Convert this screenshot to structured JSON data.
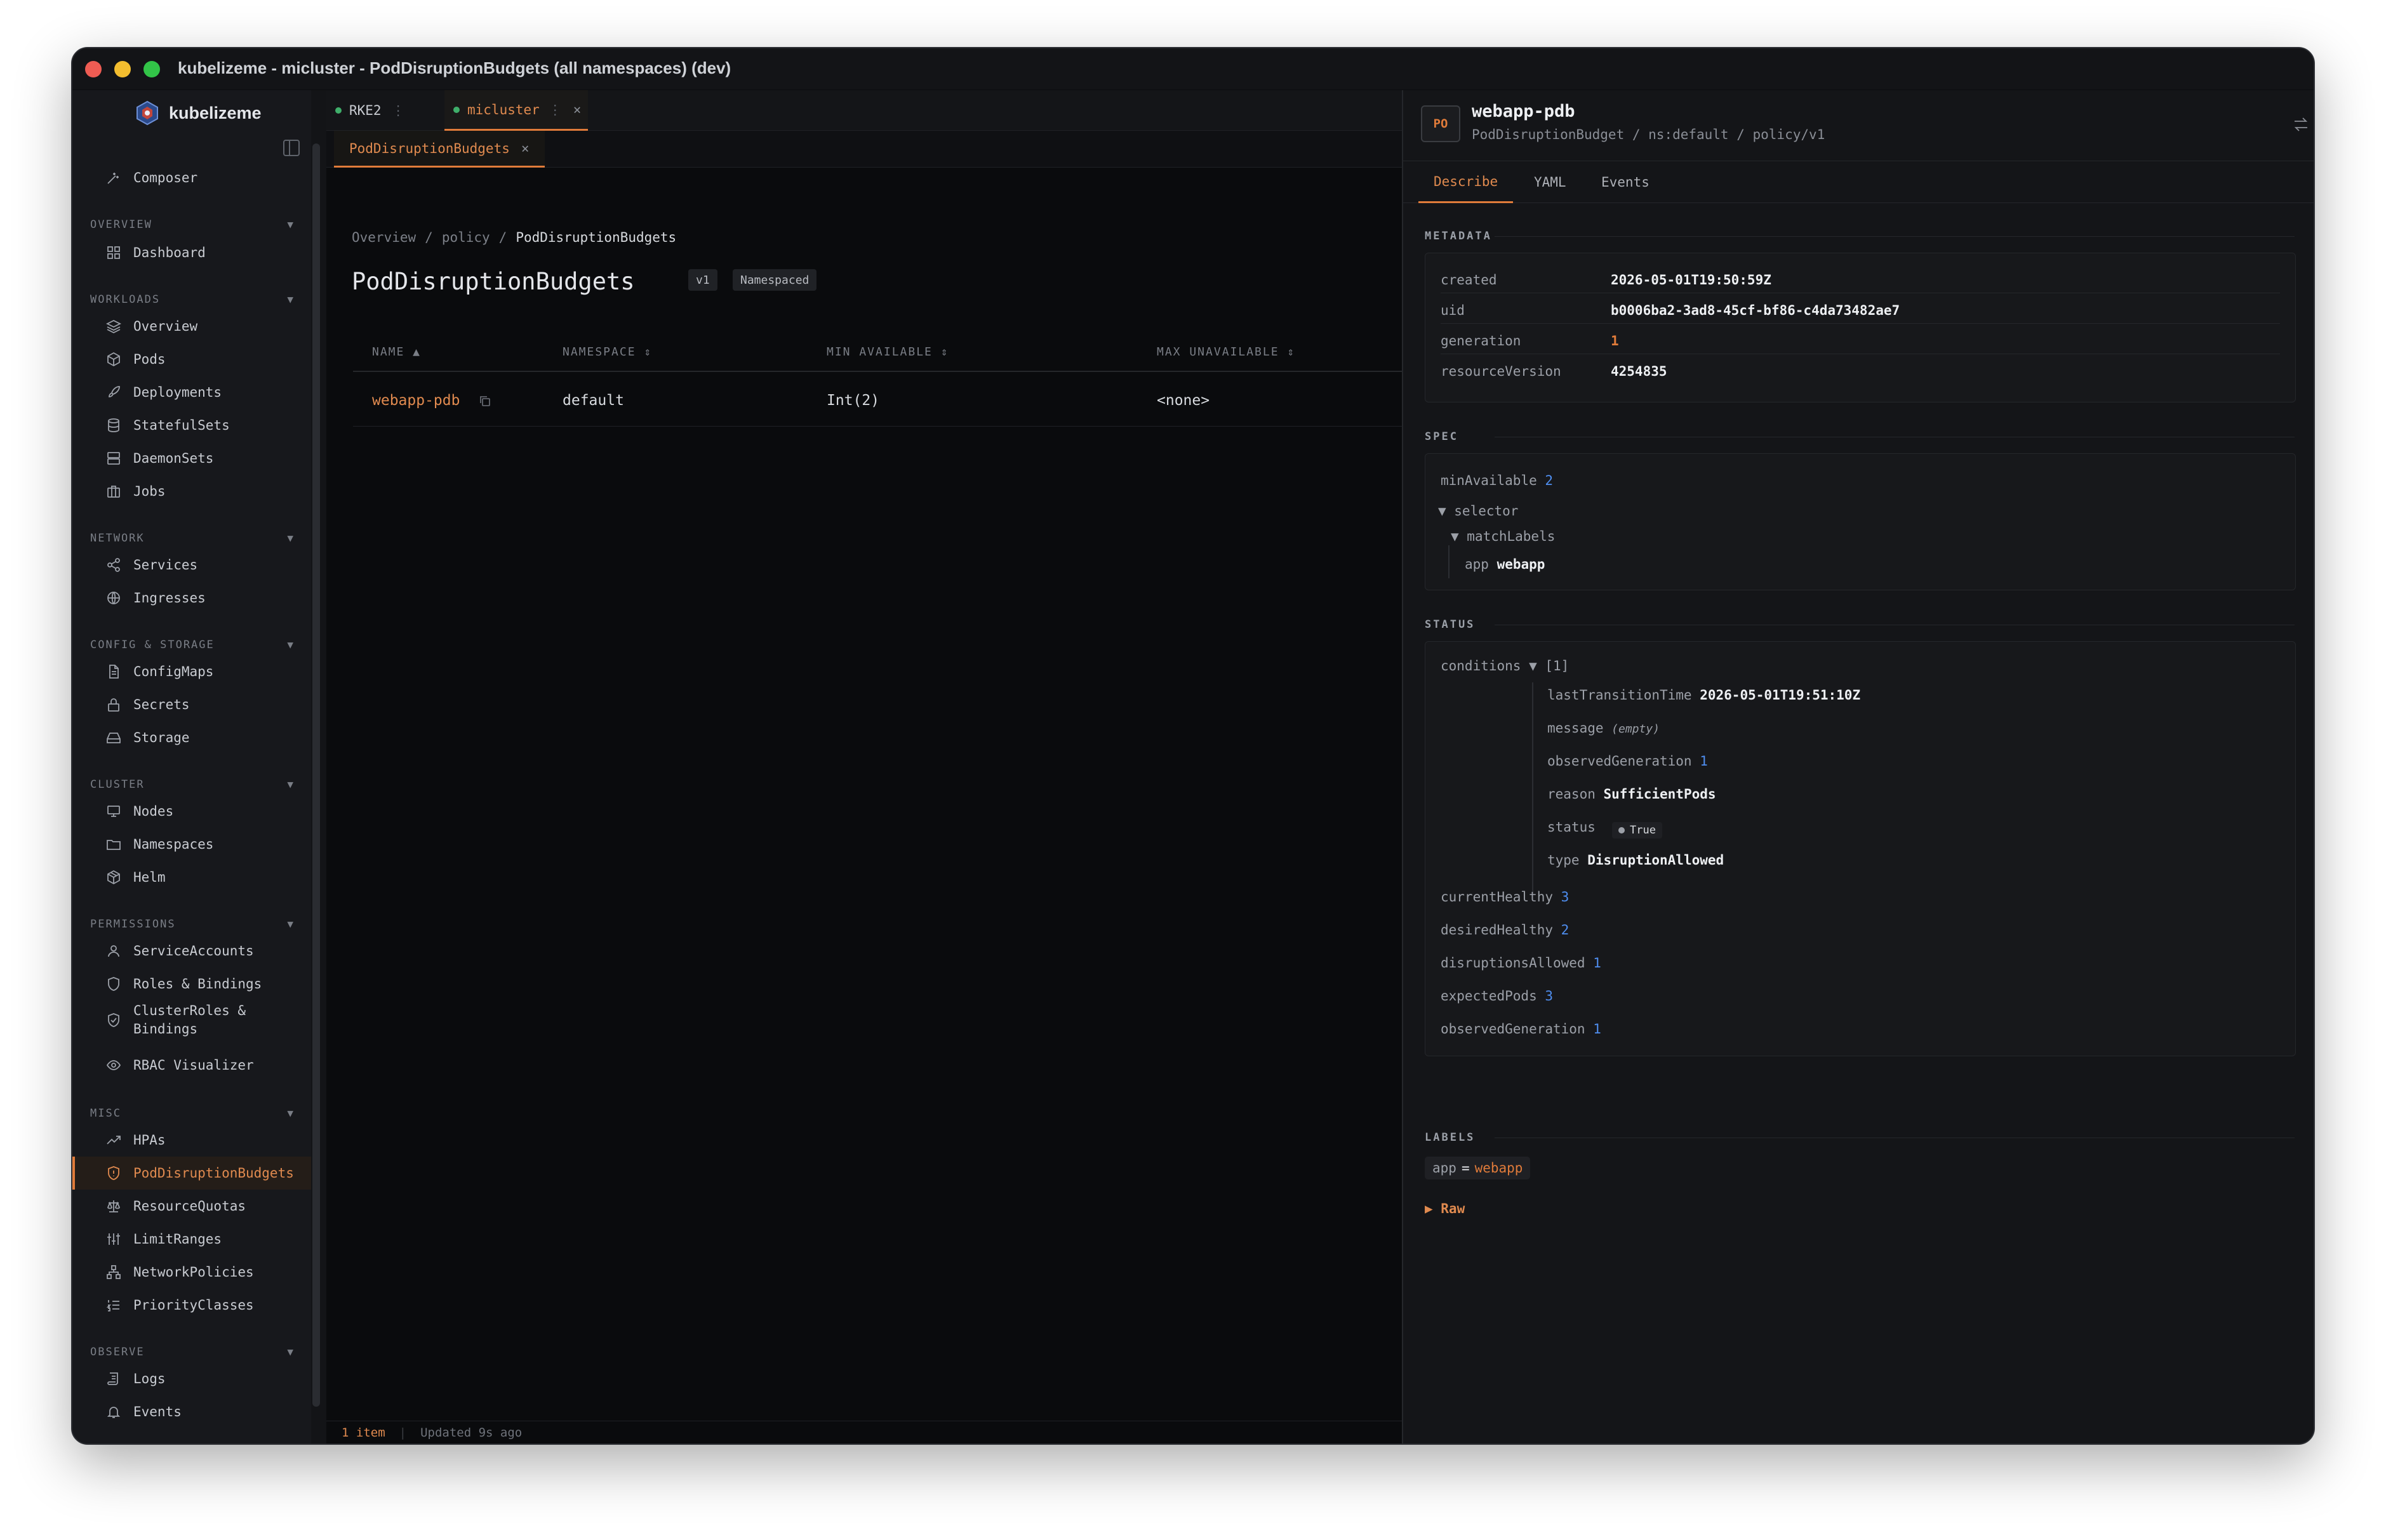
{
  "window": {
    "title": "kubelizeme - micluster - PodDisruptionBudgets (all namespaces) (dev)"
  },
  "brand": {
    "name": "kubelizeme"
  },
  "sidebar": {
    "composer": "Composer",
    "sections": {
      "overview": "OVERVIEW",
      "workloads": "WORKLOADS",
      "network": "NETWORK",
      "config": "CONFIG & STORAGE",
      "cluster": "CLUSTER",
      "permissions": "PERMISSIONS",
      "misc": "MISC",
      "observe": "OBSERVE"
    },
    "items": {
      "dashboard": "Dashboard",
      "overview": "Overview",
      "pods": "Pods",
      "deployments": "Deployments",
      "statefulsets": "StatefulSets",
      "daemonsets": "DaemonSets",
      "jobs": "Jobs",
      "services": "Services",
      "ingresses": "Ingresses",
      "configmaps": "ConfigMaps",
      "secrets": "Secrets",
      "storage": "Storage",
      "nodes": "Nodes",
      "namespaces": "Namespaces",
      "helm": "Helm",
      "serviceaccounts": "ServiceAccounts",
      "roles": "Roles & Bindings",
      "clusterroles1": "ClusterRoles &",
      "clusterroles2": "Bindings",
      "rbac": "RBAC Visualizer",
      "hpas": "HPAs",
      "pdb": "PodDisruptionBudgets",
      "resourcequotas": "ResourceQuotas",
      "limitranges": "LimitRanges",
      "networkpolicies": "NetworkPolicies",
      "priorityclasses": "PriorityClasses",
      "logs": "Logs",
      "events": "Events"
    }
  },
  "tabs": {
    "cluster1": "RKE2",
    "cluster2": "micluster",
    "close": "×",
    "sub": "PodDisruptionBudgets",
    "subclose": "×"
  },
  "breadcrumb": {
    "a": "Overview",
    "b": "policy",
    "c": "PodDisruptionBudgets",
    "sep": "/"
  },
  "page": {
    "title": "PodDisruptionBudgets",
    "version": "v1",
    "scope": "Namespaced"
  },
  "table": {
    "headers": {
      "name": "NAME ▲",
      "namespace": "NAMESPACE ⇕",
      "min": "MIN AVAILABLE ⇕",
      "max": "MAX UNAVAILABLE ⇕"
    },
    "row": {
      "name": "webapp-pdb",
      "namespace": "default",
      "min": "Int(2)",
      "max": "<none>"
    }
  },
  "footer": {
    "count": "1 item",
    "sep": "|",
    "updated": "Updated 9s ago"
  },
  "panel": {
    "kind": "PO",
    "name": "webapp-pdb",
    "sub": "PodDisruptionBudget / ns:default / policy/v1",
    "tabs": {
      "describe": "Describe",
      "yaml": "YAML",
      "events": "Events"
    },
    "metadata": {
      "head": "METADATA",
      "created_k": "created",
      "created_v": "2026-05-01T19:50:59Z",
      "uid_k": "uid",
      "uid_v": "b0006ba2-3ad8-45cf-bf86-c4da73482ae7",
      "gen_k": "generation",
      "gen_v": "1",
      "rv_k": "resourceVersion",
      "rv_v": "4254835"
    },
    "spec": {
      "head": "SPEC",
      "min_k": "minAvailable",
      "min_v": "2",
      "selector": "▼ selector",
      "match": "▼ matchLabels",
      "app_k": "app",
      "app_v": "webapp"
    },
    "status": {
      "head": "STATUS",
      "cond_k": "conditions",
      "cond_v": "▼ [1]",
      "ltt_k": "lastTransitionTime",
      "ltt_v": "2026-05-01T19:51:10Z",
      "msg_k": "message",
      "msg_v": "(empty)",
      "og_k": "observedGeneration",
      "og_v": "1",
      "reason_k": "reason",
      "reason_v": "SufficientPods",
      "status_k": "status",
      "status_v": "True",
      "type_k": "type",
      "type_v": "DisruptionAllowed",
      "ch_k": "currentHealthy",
      "ch_v": "3",
      "dh_k": "desiredHealthy",
      "dh_v": "2",
      "da_k": "disruptionsAllowed",
      "da_v": "1",
      "ep_k": "expectedPods",
      "ep_v": "3",
      "og2_k": "observedGeneration",
      "og2_v": "1"
    },
    "labels": {
      "head": "LABELS",
      "k": "app",
      "eq": "=",
      "v": "webapp"
    },
    "raw": "▶ Raw"
  }
}
